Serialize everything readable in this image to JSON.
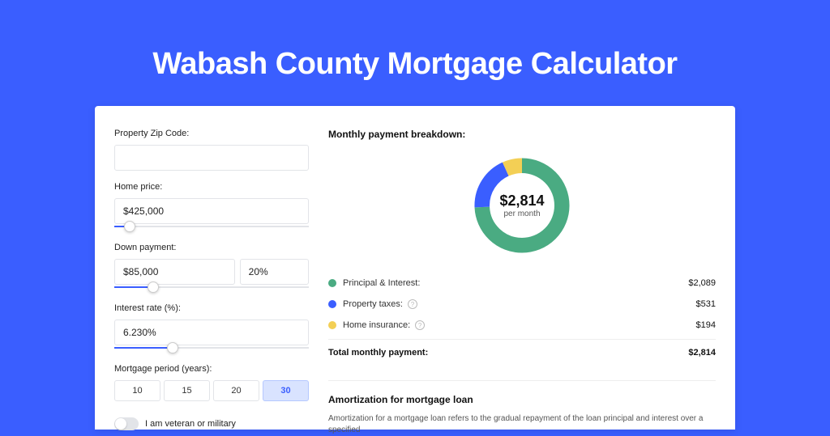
{
  "title": "Wabash County Mortgage Calculator",
  "form": {
    "zip_label": "Property Zip Code:",
    "zip_value": "",
    "price_label": "Home price:",
    "price_value": "$425,000",
    "down_label": "Down payment:",
    "down_value": "$85,000",
    "down_pct": "20%",
    "rate_label": "Interest rate (%):",
    "rate_value": "6.230%",
    "period_label": "Mortgage period (years):",
    "periods": [
      "10",
      "15",
      "20",
      "30"
    ],
    "period_active": "30",
    "veteran_label": "I am veteran or military"
  },
  "breakdown": {
    "title": "Monthly payment breakdown:",
    "total_value": "$2,814",
    "total_label": "per month",
    "items": [
      {
        "name": "Principal & Interest:",
        "value": "$2,089",
        "color": "#4aab82",
        "info": false
      },
      {
        "name": "Property taxes:",
        "value": "$531",
        "color": "#3a5eff",
        "info": true
      },
      {
        "name": "Home insurance:",
        "value": "$194",
        "color": "#f3cf55",
        "info": true
      }
    ],
    "total_row_name": "Total monthly payment:",
    "total_row_value": "$2,814"
  },
  "amortization": {
    "title": "Amortization for mortgage loan",
    "text": "Amortization for a mortgage loan refers to the gradual repayment of the loan principal and interest over a specified"
  },
  "chart_data": {
    "type": "pie",
    "title": "Monthly payment breakdown",
    "series": [
      {
        "name": "Principal & Interest",
        "value": 2089,
        "color": "#4aab82"
      },
      {
        "name": "Property taxes",
        "value": 531,
        "color": "#3a5eff"
      },
      {
        "name": "Home insurance",
        "value": 194,
        "color": "#f3cf55"
      }
    ],
    "total": 2814,
    "center_label": "$2,814 per month"
  }
}
